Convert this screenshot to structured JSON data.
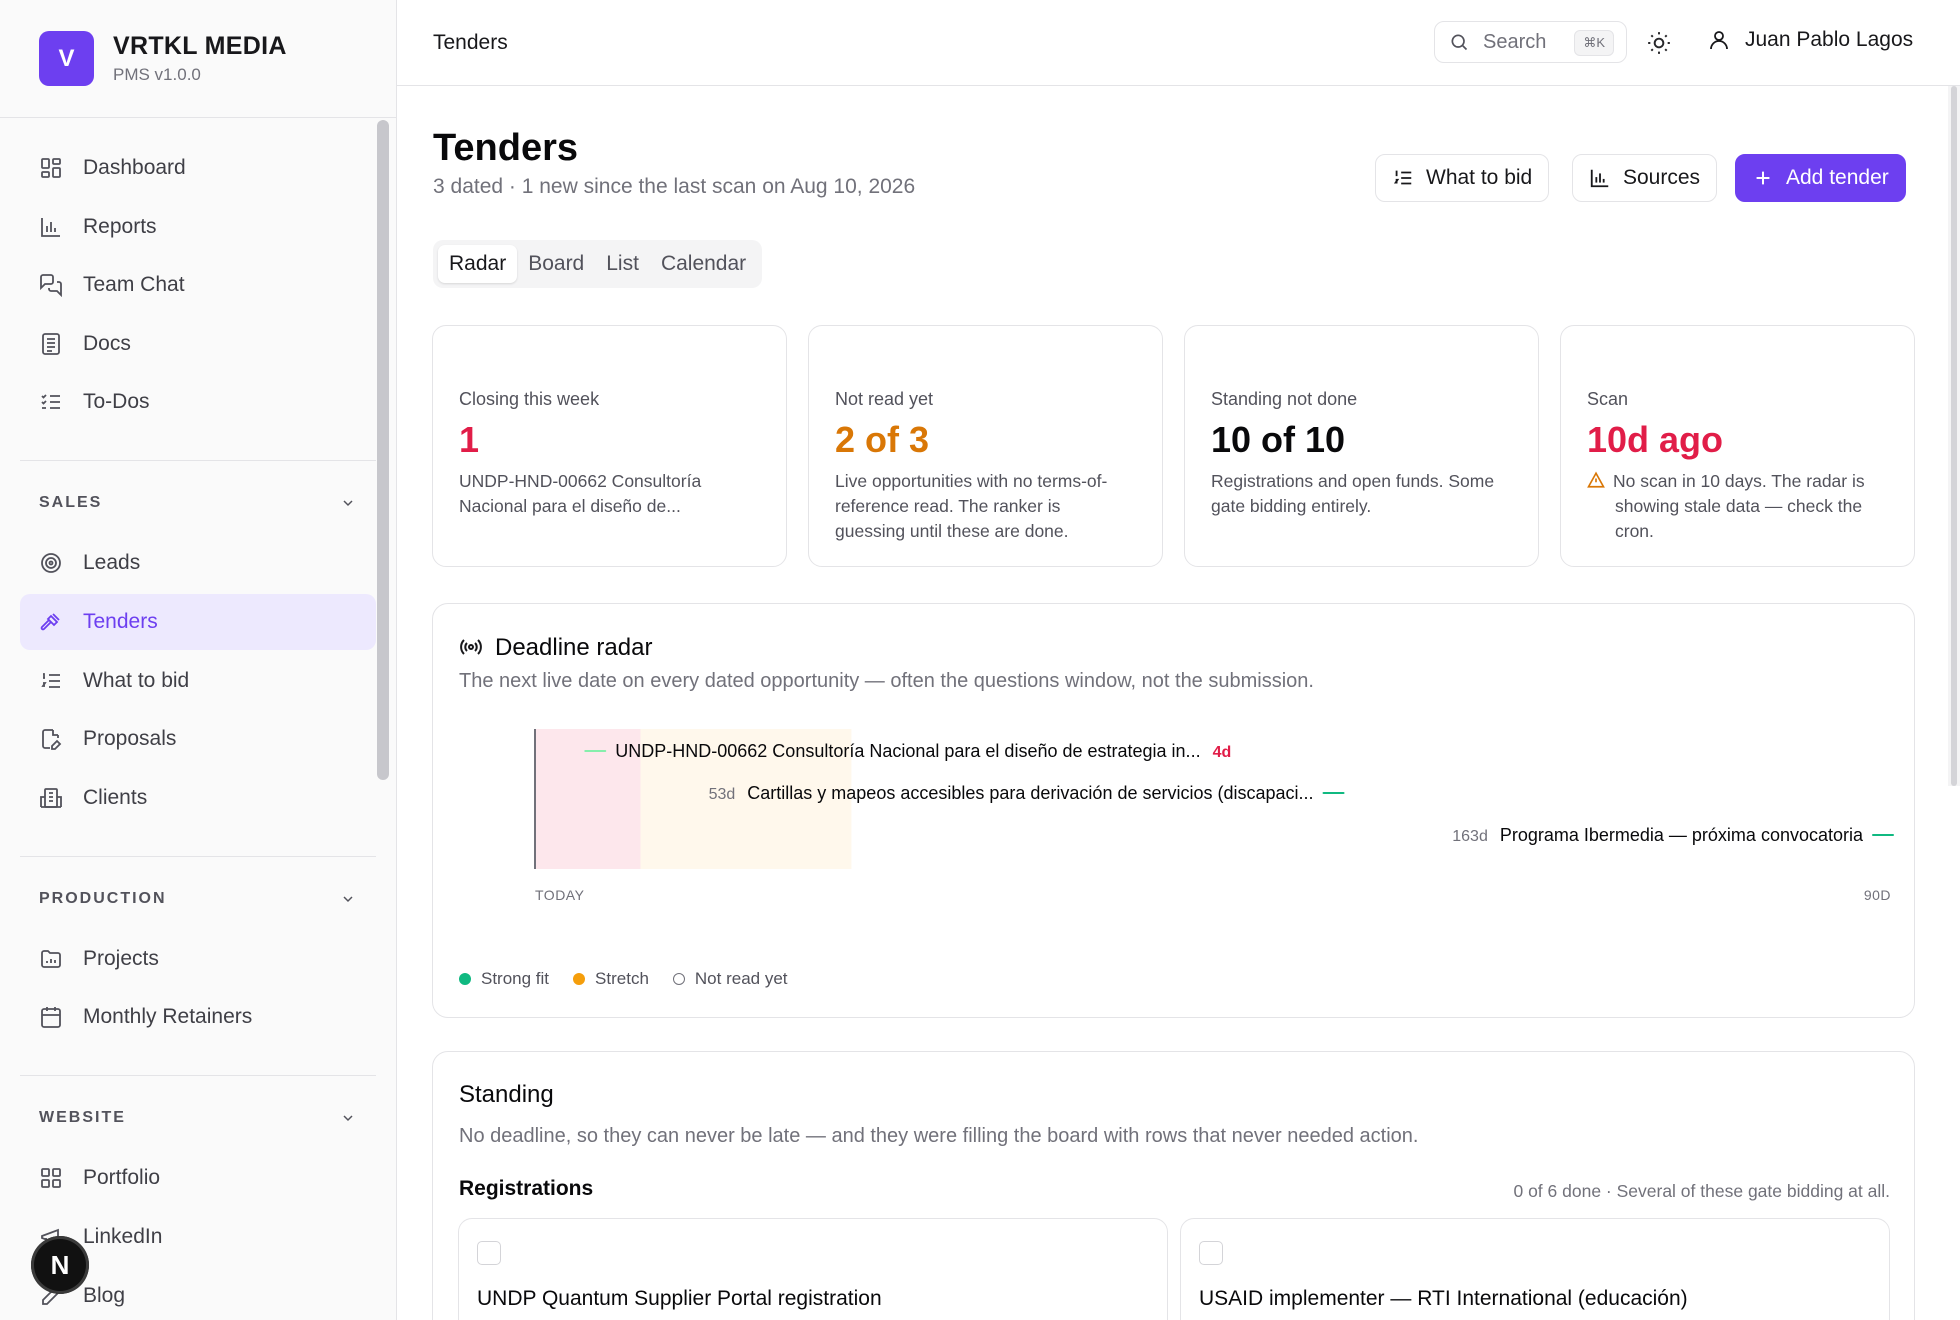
{
  "brand": {
    "logo_letter": "V",
    "name": "VRTKL MEDIA",
    "version": "PMS v1.0.0"
  },
  "sidebar": {
    "main_items": [
      {
        "label": "Dashboard",
        "icon": "grid-icon"
      },
      {
        "label": "Reports",
        "icon": "bar-chart-icon"
      },
      {
        "label": "Team Chat",
        "icon": "chat-icon"
      },
      {
        "label": "Docs",
        "icon": "document-icon"
      },
      {
        "label": "To-Dos",
        "icon": "checklist-icon"
      }
    ],
    "sales": {
      "heading": "SALES",
      "items": [
        {
          "label": "Leads",
          "icon": "target-icon"
        },
        {
          "label": "Tenders",
          "icon": "gavel-icon",
          "active": true
        },
        {
          "label": "What to bid",
          "icon": "ranked-list-icon"
        },
        {
          "label": "Proposals",
          "icon": "file-edit-icon"
        },
        {
          "label": "Clients",
          "icon": "building-icon"
        }
      ]
    },
    "production": {
      "heading": "PRODUCTION",
      "items": [
        {
          "label": "Projects",
          "icon": "folder-icon"
        },
        {
          "label": "Monthly Retainers",
          "icon": "calendar-icon"
        }
      ]
    },
    "website": {
      "heading": "WEBSITE",
      "items": [
        {
          "label": "Portfolio",
          "icon": "grid-icon"
        },
        {
          "label": "LinkedIn",
          "icon": "megaphone-icon"
        },
        {
          "label": "Blog",
          "icon": "pen-icon"
        }
      ]
    },
    "framework_badge": "N"
  },
  "topbar": {
    "title": "Tenders",
    "search_label": "Search",
    "search_shortcut": "⌘K",
    "user_name": "Juan Pablo Lagos"
  },
  "header": {
    "title": "Tenders",
    "subtitle": "3 dated · 1 new since the last scan on Aug 10, 2026",
    "buttons": {
      "what_to_bid": "What to bid",
      "sources": "Sources",
      "add_tender": "Add tender"
    }
  },
  "tabs": [
    "Radar",
    "Board",
    "List",
    "Calendar"
  ],
  "stats": [
    {
      "label": "Closing this week",
      "value": "1",
      "color": "#e11d48",
      "desc": "UNDP-HND-00662 Consultoría Nacional para el diseño de..."
    },
    {
      "label": "Not read yet",
      "value": "2 of 3",
      "color": "#d97706",
      "desc": "Live opportunities with no terms-of-reference read. The ranker is guessing until these are done."
    },
    {
      "label": "Standing not done",
      "value": "10 of 10",
      "color": "#09090b",
      "desc": "Registrations and open funds. Some gate bidding entirely."
    },
    {
      "label": "Scan",
      "value": "10d ago",
      "color": "#e11d48",
      "desc": "No scan in 10 days. The radar is showing stale data — check the cron."
    }
  ],
  "radar": {
    "title": "Deadline radar",
    "subtitle": "The next live date on every dated opportunity — often the questions window, not the submission.",
    "axis_start": "TODAY",
    "axis_end": "90D",
    "axis_max_days": 90,
    "zones": [
      {
        "from_days": 0,
        "to_days": 7,
        "color": "#fde7ec"
      },
      {
        "from_days": 7,
        "to_days": 21,
        "color": "#fff8ec"
      }
    ],
    "items": [
      {
        "title": "UNDP-HND-00662 Consultoría Nacional para el diseño de estrategia in...",
        "days": 4,
        "days_label": "4d",
        "label_side": "after",
        "fit": "not-read"
      },
      {
        "title": "Cartillas y mapeos accesibles para derivación de servicios (discapaci...",
        "days": 53,
        "days_label": "53d",
        "label_side": "before",
        "fit": "strong"
      },
      {
        "title": "Programa Ibermedia — próxima convocatoria",
        "days": 163,
        "days_label": "163d",
        "label_side": "before",
        "fit": "strong"
      }
    ],
    "legend": [
      {
        "label": "Strong fit",
        "color": "#10b981",
        "filled": true
      },
      {
        "label": "Stretch",
        "color": "#f59e0b",
        "filled": true
      },
      {
        "label": "Not read yet",
        "color": "#71717a",
        "filled": false
      }
    ],
    "colors": {
      "urgent": "#e11d48",
      "bar": "#10b981",
      "axis": "#71717a"
    }
  },
  "standing": {
    "title": "Standing",
    "subtitle": "No deadline, so they can never be late — and they were filling the board with rows that never needed action.",
    "registrations_heading": "Registrations",
    "registrations_summary": "0 of 6 done · Several of these gate bidding at all.",
    "registrations": [
      {
        "title": "UNDP Quantum Supplier Portal registration"
      },
      {
        "title": "USAID implementer — RTI International (educación)"
      }
    ]
  }
}
